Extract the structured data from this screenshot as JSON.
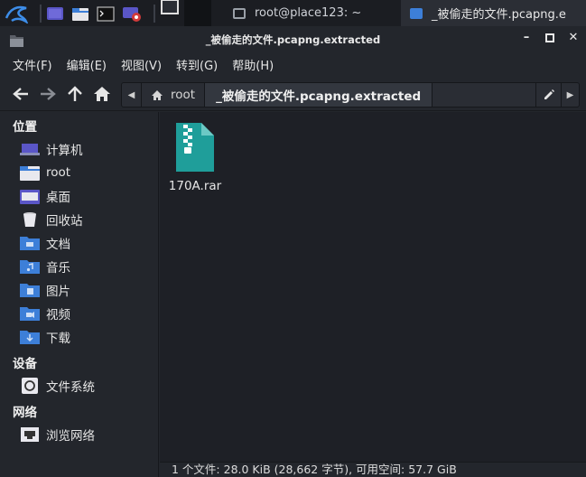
{
  "taskbar": {
    "tasks": [
      {
        "label": "root@place123: ~"
      },
      {
        "label": "_被偷走的文件.pcapng.e"
      }
    ]
  },
  "window": {
    "title": "_被偷走的文件.pcapng.extracted"
  },
  "menu": {
    "file": "文件(F)",
    "edit": "编辑(E)",
    "view": "视图(V)",
    "go": "转到(G)",
    "help": "帮助(H)"
  },
  "path": {
    "crumbs": [
      {
        "label": "root"
      },
      {
        "label": "_被偷走的文件.pcapng.extracted"
      }
    ]
  },
  "sidebar": {
    "places_title": "位置",
    "places": [
      {
        "label": "计算机",
        "icon": "computer-icon"
      },
      {
        "label": "root",
        "icon": "home-folder-icon"
      },
      {
        "label": "桌面",
        "icon": "desktop-folder-icon"
      },
      {
        "label": "回收站",
        "icon": "trash-icon"
      },
      {
        "label": "文档",
        "icon": "documents-folder-icon"
      },
      {
        "label": "音乐",
        "icon": "music-folder-icon"
      },
      {
        "label": "图片",
        "icon": "pictures-folder-icon"
      },
      {
        "label": "视频",
        "icon": "videos-folder-icon"
      },
      {
        "label": "下载",
        "icon": "downloads-folder-icon"
      }
    ],
    "devices_title": "设备",
    "devices": [
      {
        "label": "文件系统",
        "icon": "drive-icon"
      }
    ],
    "network_title": "网络",
    "network": [
      {
        "label": "浏览网络",
        "icon": "network-icon"
      }
    ]
  },
  "files": [
    {
      "name": "170A.rar",
      "icon": "archive-icon"
    }
  ],
  "status": {
    "text": "1 个文件: 28.0 KiB (28,662 字节), 可用空间: 57.7 GiB"
  },
  "colors": {
    "folder": "#3d7fd8",
    "archive": "#1f9e9a",
    "background": "#1e2026"
  }
}
